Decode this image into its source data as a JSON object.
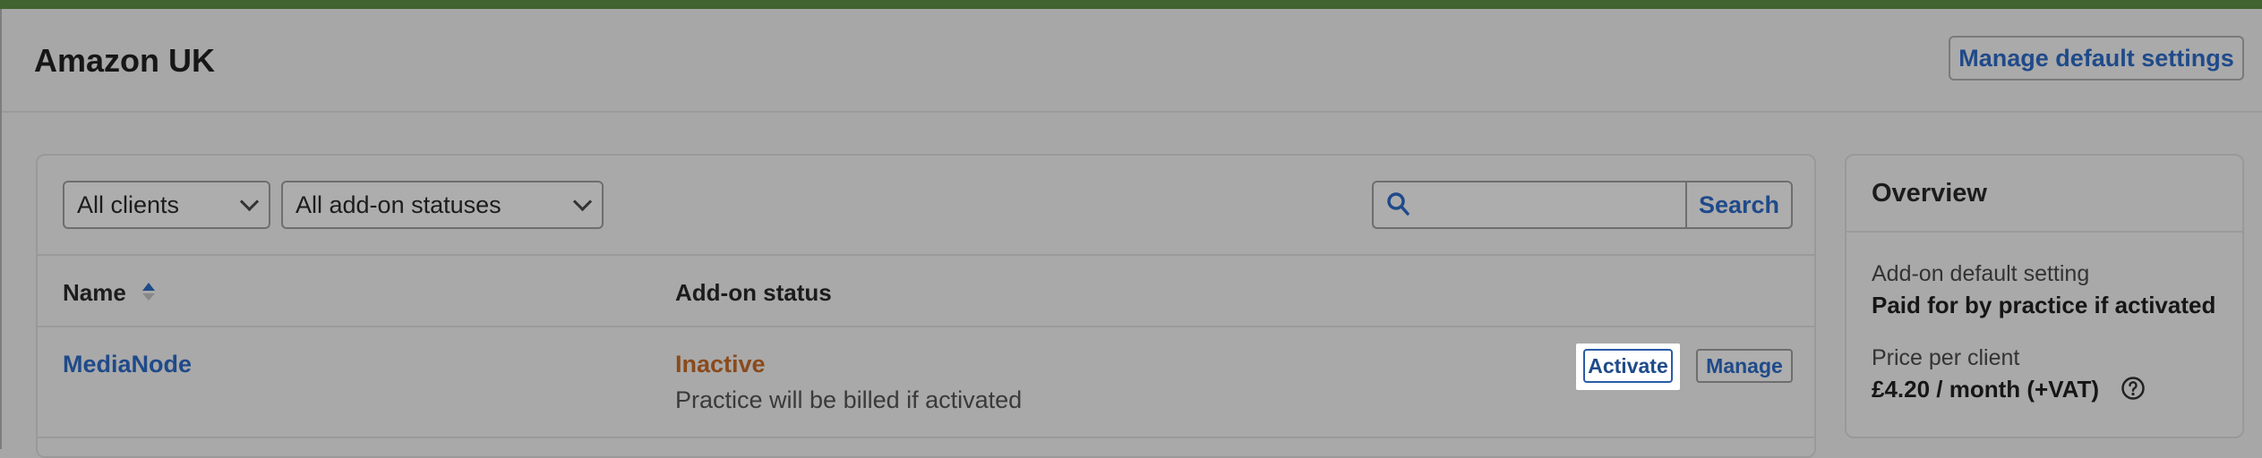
{
  "header": {
    "title": "Amazon UK",
    "manage_default_label": "Manage default settings"
  },
  "filters": {
    "client_select": "All clients",
    "status_select": "All add-on statuses",
    "search_placeholder": "",
    "search_label": "Search"
  },
  "table": {
    "columns": [
      "Name",
      "Add-on status"
    ],
    "rows": [
      {
        "name": "MediaNode",
        "status": "Inactive",
        "note": "Practice will be billed if activated",
        "activate_label": "Activate",
        "manage_label": "Manage"
      }
    ]
  },
  "overview": {
    "title": "Overview",
    "default_setting_label": "Add-on default setting",
    "default_setting_value": "Paid for by practice if activated",
    "price_label": "Price per client",
    "price_value": "£4.20 / month (+VAT)"
  },
  "colors": {
    "accent": "#1f4a8a",
    "status_inactive": "#8a4a1c",
    "topbar": "#41632f"
  },
  "icons": [
    "search-icon",
    "sort-icon",
    "chevron-down-icon",
    "help-icon"
  ]
}
